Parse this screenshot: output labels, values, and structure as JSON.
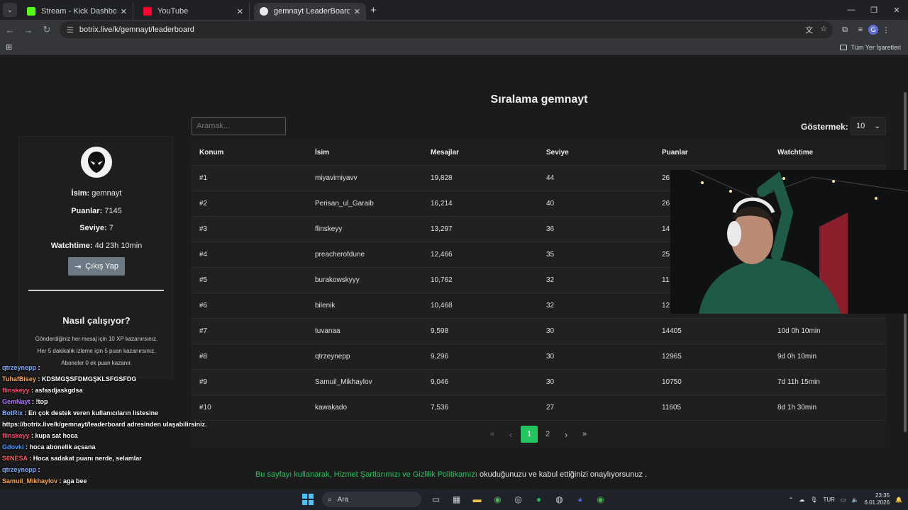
{
  "browser": {
    "tabs": [
      {
        "title": "Stream - Kick Dashboard",
        "color": "#53fc18"
      },
      {
        "title": "YouTube",
        "color": "#ff0033"
      },
      {
        "title": "gemnayt LeaderBoard | The be",
        "color": "#e8eaed"
      }
    ],
    "url": "botrix.live/k/gemnayt/leaderboard",
    "bookmarks_all": "Tüm Yer İşaretleri"
  },
  "page": {
    "heading": "Sıralama gemnayt",
    "search_placeholder": "Aramak...",
    "show_label": "Göstermek:",
    "show_value": "10"
  },
  "profile": {
    "name_label": "İsim:",
    "name": "gemnayt",
    "points_label": "Puanlar:",
    "points": "7145",
    "level_label": "Seviye:",
    "level": "7",
    "watchtime_label": "Watchtime:",
    "watchtime": "4d 23h 10min",
    "logout": "Çıkış Yap",
    "how_title": "Nasıl çalışıyor?",
    "info": [
      "Gönderdiğiniz her mesaj için 10 XP kazanırsınız.",
      "Her 5 dakikalık izleme için 5 puan kazanırsınız.",
      "Aboneler 0 ek puan kazanır."
    ]
  },
  "table": {
    "headers": [
      "Konum",
      "İsim",
      "Mesajlar",
      "Seviye",
      "Puanlar",
      "Watchtime"
    ],
    "rows": [
      [
        "#1",
        "miyavimiyavv",
        "19,828",
        "44",
        "26",
        ""
      ],
      [
        "#2",
        "Perisan_ul_Garaib",
        "16,214",
        "40",
        "26",
        ""
      ],
      [
        "#3",
        "flinskeyy",
        "13,297",
        "36",
        "14",
        ""
      ],
      [
        "#4",
        "preacherofdune",
        "12,466",
        "35",
        "25",
        ""
      ],
      [
        "#5",
        "burakowskyyy",
        "10,762",
        "32",
        "11",
        ""
      ],
      [
        "#6",
        "bilenik",
        "10,468",
        "32",
        "12",
        ""
      ],
      [
        "#7",
        "tuvanaa",
        "9,598",
        "30",
        "14405",
        "10d 0h 10min"
      ],
      [
        "#8",
        "qtrzeynepp",
        "9,296",
        "30",
        "12965",
        "9d 0h 10min"
      ],
      [
        "#9",
        "Samuil_Mikhaylov",
        "9,046",
        "30",
        "10750",
        "7d 11h 15min"
      ],
      [
        "#10",
        "kawakado",
        "7,536",
        "27",
        "11605",
        "8d 1h 30min"
      ]
    ]
  },
  "pagination": {
    "first": "«",
    "prev": "‹",
    "current": "1",
    "page2": "2",
    "next": "›",
    "last": "»"
  },
  "footer": {
    "link_text": "Bu sayfayı kullanarak, Hizmet Şartlarımızı ve Gizlilik Politikamızı",
    "rest_text": " okuduğunuzu ve kabul ettiğinizi onaylıyorsunuz ."
  },
  "chat": [
    {
      "user": "qtrzeynepp",
      "text": "",
      "color": "#7fb2ff"
    },
    {
      "user": "TuhafBisey",
      "text": "KDSMGŞSFDMGŞKLSFGSFDG",
      "color": "#ffa94d"
    },
    {
      "user": "flinskeyy",
      "text": "asfasdjaskgdsa",
      "color": "#ff4d6d"
    },
    {
      "user": "GemNayt",
      "text": "!top",
      "color": "#b57bff"
    },
    {
      "user": "BotRix",
      "text": "En çok destek veren kullanıcıların listesine",
      "color": "#7fb2ff"
    },
    {
      "user": "",
      "text": "https://botrix.live/k/gemnayt/leaderboard adresinden ulaşabilirsiniz.",
      "color": "#ffffff"
    },
    {
      "user": "flinskeyy",
      "text": "kupa sat hoca",
      "color": "#ff4d6d"
    },
    {
      "user": "Gdovki",
      "text": "hoca abonelik açsana",
      "color": "#4d9bff"
    },
    {
      "user": "S6NESA",
      "text": "Hoca sadakat puanı nerde, selamlar",
      "color": "#ff5a5a"
    },
    {
      "user": "qtrzeynepp",
      "text": "",
      "color": "#7fb2ff"
    },
    {
      "user": "Samuil_Mikhaylov",
      "text": "aga bee",
      "color": "#ffa94d"
    },
    {
      "user": "qtrzeynepp",
      "text": "",
      "color": "#7fb2ff"
    }
  ],
  "taskbar": {
    "search_label": "Ara",
    "lang": "TUR",
    "time": "23:35",
    "date": "6.01.2026"
  }
}
